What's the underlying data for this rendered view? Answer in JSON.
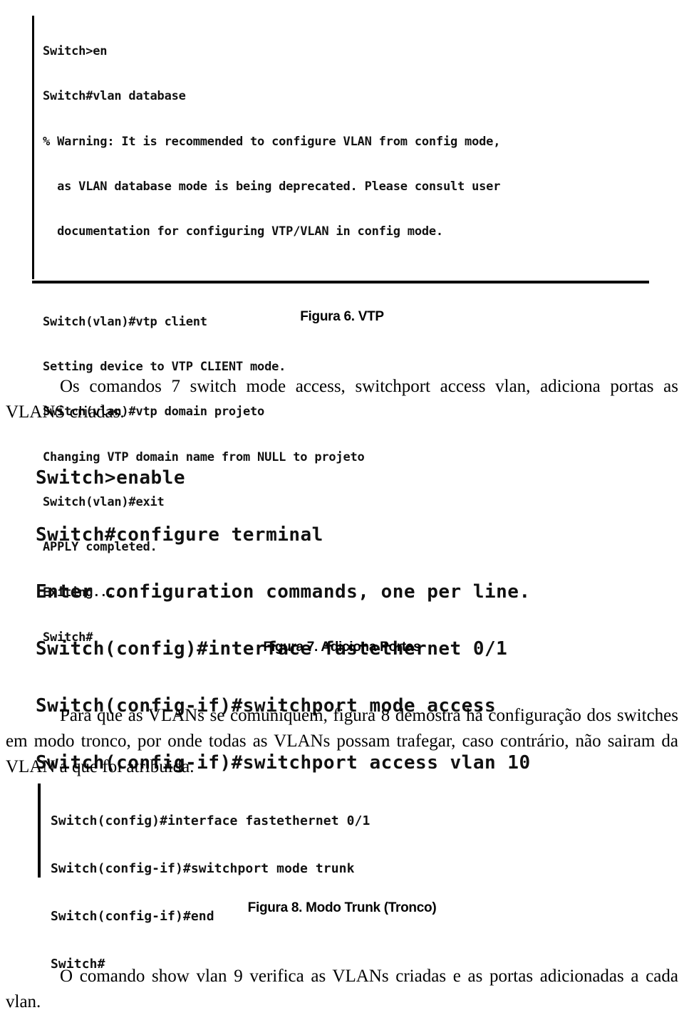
{
  "document": {
    "language": "pt-BR",
    "page_background": "#ffffff",
    "text_color": "#000000"
  },
  "figures": {
    "fig6": {
      "caption": "Figura 6. VTP",
      "console_lines": [
        "Switch>en",
        "Switch#vlan database",
        "% Warning: It is recommended to configure VLAN from config mode,",
        "  as VLAN database mode is being deprecated. Please consult user",
        "  documentation for configuring VTP/VLAN in config mode.",
        "",
        "Switch(vlan)#vtp client",
        "Setting device to VTP CLIENT mode.",
        "Switch(vlan)#vtp domain projeto",
        "Changing VTP domain name from NULL to projeto",
        "Switch(vlan)#exit",
        "APPLY completed.",
        "Exiting....",
        "Switch#"
      ]
    },
    "fig7": {
      "caption": "Figura 7. Adiciona Portas",
      "console_lines": [
        "Switch>enable",
        "Switch#configure terminal",
        "Enter configuration commands, one per line.",
        "Switch(config)#interface fastethernet 0/1",
        "Switch(config-if)#switchport mode access",
        "Switch(config-if)#switchport access vlan 10"
      ]
    },
    "fig8": {
      "caption": "Figura 8. Modo Trunk (Tronco)",
      "console_lines": [
        "Switch(config)#interface fastethernet 0/1",
        "Switch(config-if)#switchport mode trunk",
        "Switch(config-if)#end",
        "Switch#"
      ]
    }
  },
  "paragraphs": {
    "access_ports": "Os comandos 7 switch mode access, switchport access vlan, adiciona portas as VLANS criadas.",
    "trunk_mode": "Para que as VLANs se comuniquem, figura 8 demostra há configuração dos switches em modo tronco, por onde todas as VLANs possam trafegar, caso contrário, não sairam da VLAN a que foi atribuida.",
    "show_vlan": "O comando show vlan 9 verifica as VLANs criadas e as portas adicionadas a cada vlan."
  }
}
